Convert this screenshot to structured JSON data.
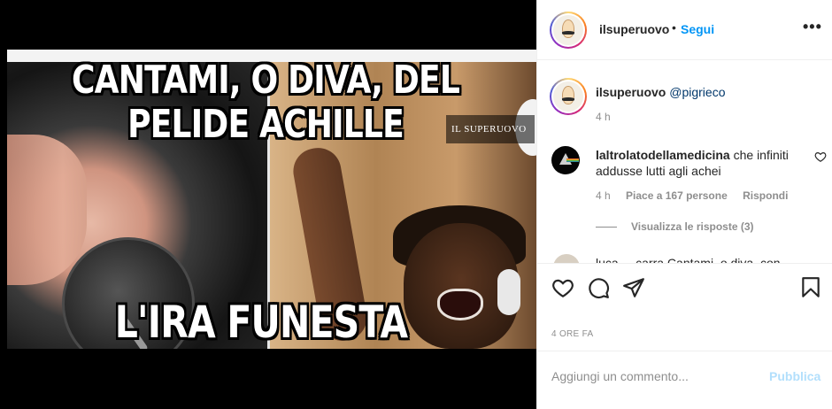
{
  "post": {
    "image": {
      "caption_top": "CANTAMI, O DIVA, DEL PELIDE ACHILLE",
      "caption_bottom": "L'IRA FUNESTA",
      "watermark": "IL SUPERUOVO"
    }
  },
  "header": {
    "username": "ilsuperuovo",
    "separator": "•",
    "follow_label": "Segui",
    "more_icon": "more-horizontal-icon"
  },
  "caption": {
    "username": "ilsuperuovo",
    "mention": "@pigrieco",
    "time": "4 h"
  },
  "comment": {
    "username": "laltrolatodellamedicina",
    "text": "che infiniti addusse lutti agli achei",
    "time": "4 h",
    "likes": "Piace a 167 persone",
    "reply_label": "Rispondi",
    "view_replies": "Visualizza le risposte (3)"
  },
  "next_comment": {
    "text": "luca__ carra Cantami, o diva, con"
  },
  "actions": {
    "icons": [
      "heart-icon",
      "comment-icon",
      "share-icon",
      "bookmark-icon"
    ]
  },
  "timestamp": "4 ORE FA",
  "add_comment": {
    "placeholder": "Aggiungi un commento...",
    "publish_label": "Pubblica"
  },
  "colors": {
    "link_blue": "#0095f6",
    "publish_disabled": "#b2dffc",
    "muted": "#8e8e8e"
  }
}
